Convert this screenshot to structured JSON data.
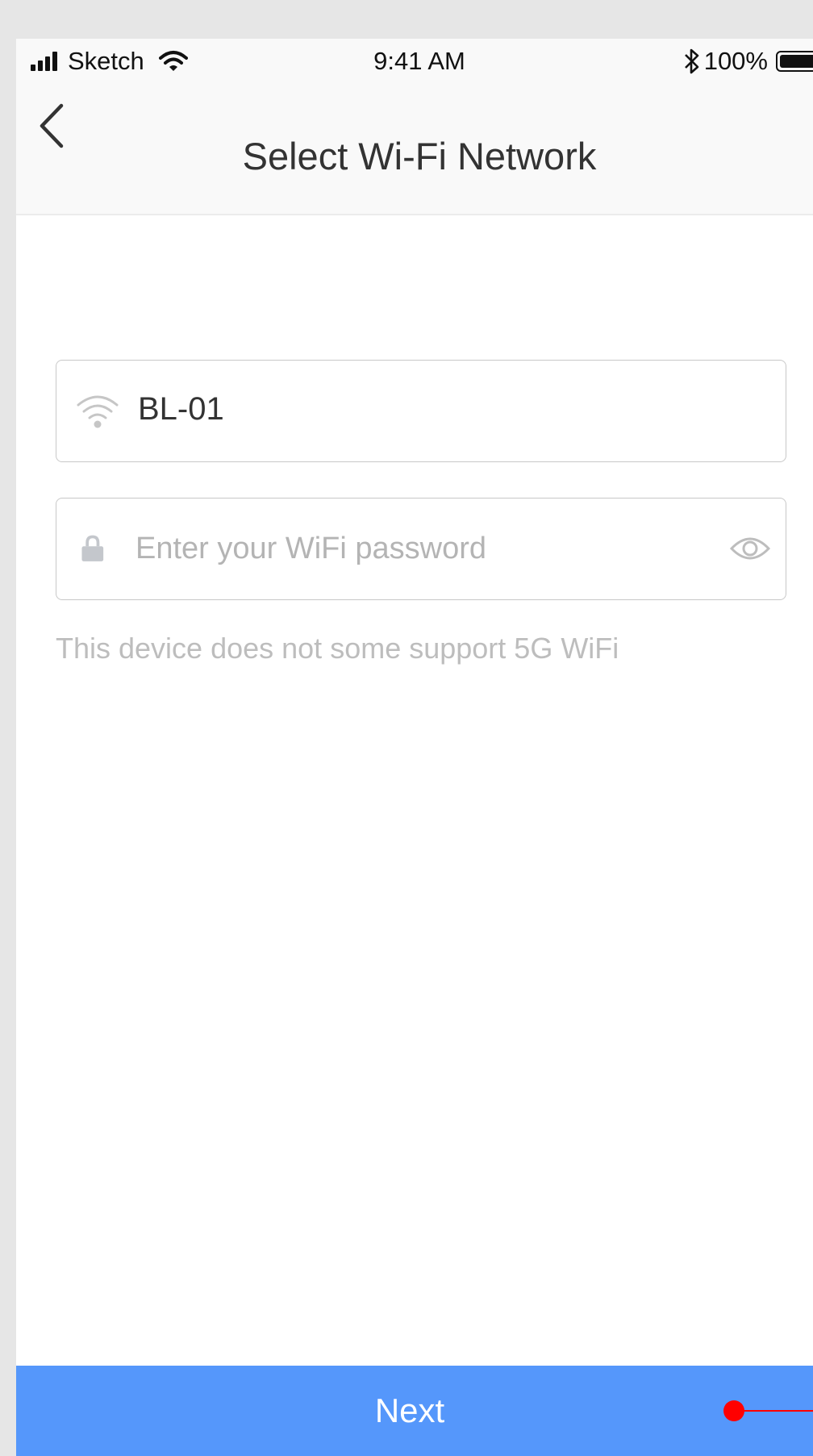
{
  "status_bar": {
    "carrier": "Sketch",
    "time": "9:41 AM",
    "battery_percent": "100%",
    "battery_level": 1.0,
    "icons": [
      "signal-icon",
      "wifi-icon",
      "bluetooth-icon",
      "battery-icon"
    ]
  },
  "nav": {
    "title": "Select Wi-Fi Network",
    "back_icon": "chevron-left-icon"
  },
  "ssid_field": {
    "icon": "wifi-icon",
    "value": "BL-01"
  },
  "password_field": {
    "icon": "lock-icon",
    "value": "",
    "placeholder": "Enter your WiFi password",
    "toggle_icon": "eye-icon"
  },
  "hint": "This device does not some support 5G WiFi",
  "next_button": {
    "label": "Next"
  },
  "colors": {
    "accent": "#5597fb",
    "annotation": "#ff0000",
    "hint_text": "#bdbdbd",
    "title_text": "#333333"
  }
}
